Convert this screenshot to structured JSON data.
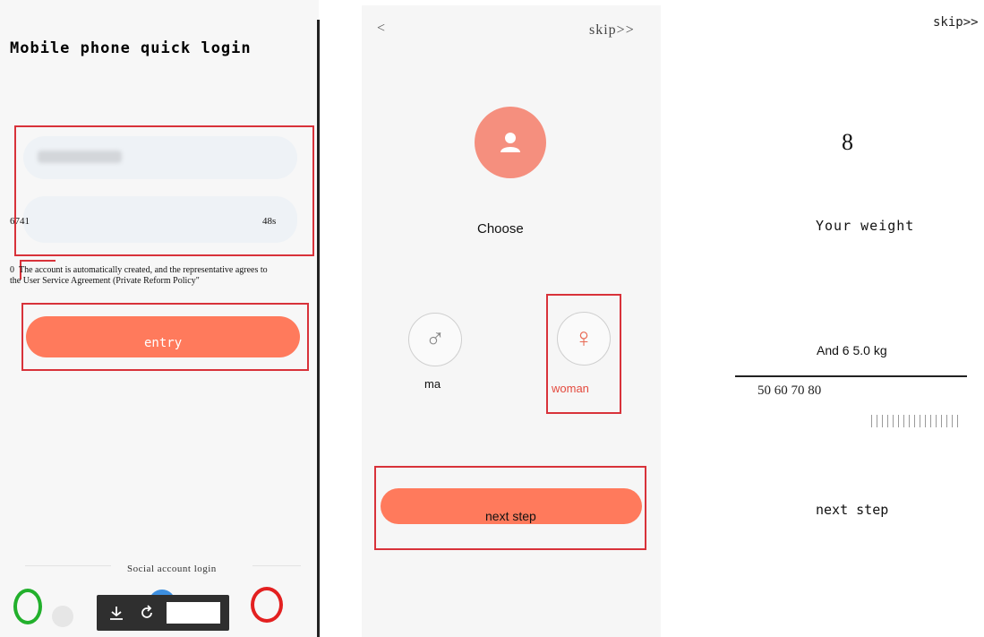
{
  "panel1": {
    "title": "Mobile phone quick login",
    "code_value": "6741",
    "countdown": "48s",
    "agreement_prefix": "0",
    "agreement_text": "The account is automatically created, and the representative agrees to the User Service Agreement (Private Reform Policy\"",
    "entry_label": "entry",
    "social_label": "Social account login"
  },
  "panel2": {
    "back_glyph": "<",
    "skip_label": "skip>>",
    "choose_label": "Choose",
    "male_label": "ma",
    "female_label": "woman",
    "next_label": "next step"
  },
  "panel3": {
    "skip_label": "skip>>",
    "number": "8",
    "weight_title": "Your weight",
    "weight_value": "And 6 5.0 kg",
    "scale_labels": "50 60 70 80",
    "next_label": "next step"
  },
  "colors": {
    "accent": "#ff7a5c",
    "highlight_box": "#d8323a",
    "green_marker": "#22b02c",
    "red_marker": "#e32020"
  },
  "icons": [
    "download-icon",
    "rotate-icon",
    "male-symbol-icon",
    "female-symbol-icon",
    "user-avatar-icon"
  ]
}
